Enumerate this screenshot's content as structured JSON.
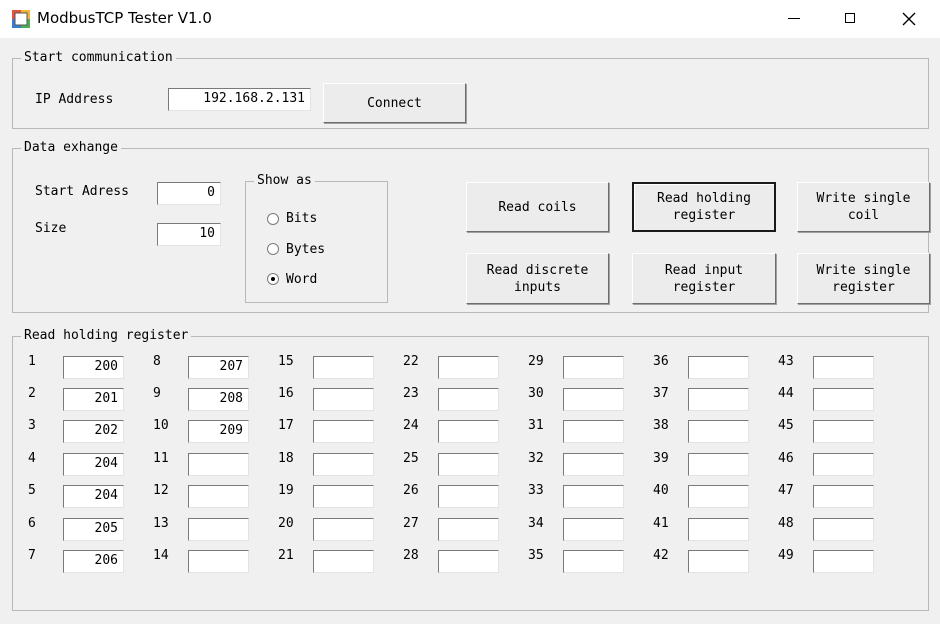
{
  "window": {
    "title": "ModbusTCP Tester V1.0"
  },
  "start_comm": {
    "legend": "Start communication",
    "ip_label": "IP Address",
    "ip_value": "192.168.2.131",
    "connect_label": "Connect"
  },
  "data_exchange": {
    "legend": "Data exhange",
    "start_label": "Start Adress",
    "start_value": "0",
    "size_label": "Size",
    "size_value": "10",
    "show_as": {
      "legend": "Show as",
      "options": [
        {
          "label": "Bits",
          "checked": false
        },
        {
          "label": "Bytes",
          "checked": false
        },
        {
          "label": "Word",
          "checked": true
        }
      ]
    },
    "buttons": [
      "Read coils",
      "Read holding\nregister",
      "Write single\ncoil",
      "Read discrete\ninputs",
      "Read input\nregister",
      "Write single\nregister"
    ]
  },
  "registers": {
    "legend": "Read holding register",
    "cells": [
      {
        "label": "1",
        "value": "200"
      },
      {
        "label": "2",
        "value": "201"
      },
      {
        "label": "3",
        "value": "202"
      },
      {
        "label": "4",
        "value": "204"
      },
      {
        "label": "5",
        "value": "204"
      },
      {
        "label": "6",
        "value": "205"
      },
      {
        "label": "7",
        "value": "206"
      },
      {
        "label": "8",
        "value": "207"
      },
      {
        "label": "9",
        "value": "208"
      },
      {
        "label": "10",
        "value": "209"
      },
      {
        "label": "11",
        "value": ""
      },
      {
        "label": "12",
        "value": ""
      },
      {
        "label": "13",
        "value": ""
      },
      {
        "label": "14",
        "value": ""
      },
      {
        "label": "15",
        "value": ""
      },
      {
        "label": "16",
        "value": ""
      },
      {
        "label": "17",
        "value": ""
      },
      {
        "label": "18",
        "value": ""
      },
      {
        "label": "19",
        "value": ""
      },
      {
        "label": "20",
        "value": ""
      },
      {
        "label": "21",
        "value": ""
      },
      {
        "label": "22",
        "value": ""
      },
      {
        "label": "23",
        "value": ""
      },
      {
        "label": "24",
        "value": ""
      },
      {
        "label": "25",
        "value": ""
      },
      {
        "label": "26",
        "value": ""
      },
      {
        "label": "27",
        "value": ""
      },
      {
        "label": "28",
        "value": ""
      },
      {
        "label": "29",
        "value": ""
      },
      {
        "label": "30",
        "value": ""
      },
      {
        "label": "31",
        "value": ""
      },
      {
        "label": "32",
        "value": ""
      },
      {
        "label": "33",
        "value": ""
      },
      {
        "label": "34",
        "value": ""
      },
      {
        "label": "35",
        "value": ""
      },
      {
        "label": "36",
        "value": ""
      },
      {
        "label": "37",
        "value": ""
      },
      {
        "label": "38",
        "value": ""
      },
      {
        "label": "39",
        "value": ""
      },
      {
        "label": "40",
        "value": ""
      },
      {
        "label": "41",
        "value": ""
      },
      {
        "label": "42",
        "value": ""
      },
      {
        "label": "43",
        "value": ""
      },
      {
        "label": "44",
        "value": ""
      },
      {
        "label": "45",
        "value": ""
      },
      {
        "label": "46",
        "value": ""
      },
      {
        "label": "47",
        "value": ""
      },
      {
        "label": "48",
        "value": ""
      },
      {
        "label": "49",
        "value": ""
      }
    ]
  }
}
